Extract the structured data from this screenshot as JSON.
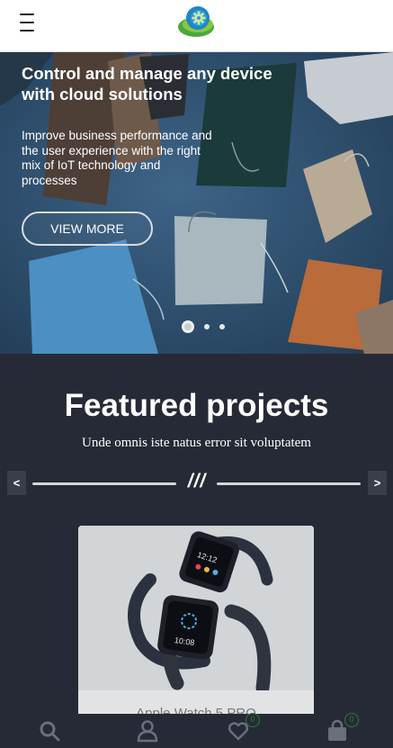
{
  "header": {
    "menu_icon": "hamburger-menu-icon",
    "logo_icon": "gear-leaf-logo"
  },
  "hero": {
    "title": "Control and manage any device with cloud solutions",
    "description": "Improve business performance and the user experience with the right mix of IoT technology and processes",
    "button_label": "VIEW MORE",
    "slides_count": 3,
    "active_slide": 1
  },
  "featured": {
    "title": "Featured projects",
    "subtitle": "Unde omnis iste natus error sit voluptatem",
    "prev_label": "<",
    "next_label": ">",
    "divider_mark": "///",
    "card": {
      "name": "Apple Watch 5 PRO",
      "image": "smartwatch-photo"
    }
  },
  "bottom_bar": {
    "items": [
      {
        "icon": "search-icon"
      },
      {
        "icon": "user-icon"
      },
      {
        "icon": "heart-icon",
        "badge": "0"
      },
      {
        "icon": "shopping-bag-icon",
        "badge": "0"
      }
    ]
  },
  "colors": {
    "dark_bg": "#262a36",
    "accent_badge": "#2e7d32",
    "header_bg": "#ffffff"
  }
}
